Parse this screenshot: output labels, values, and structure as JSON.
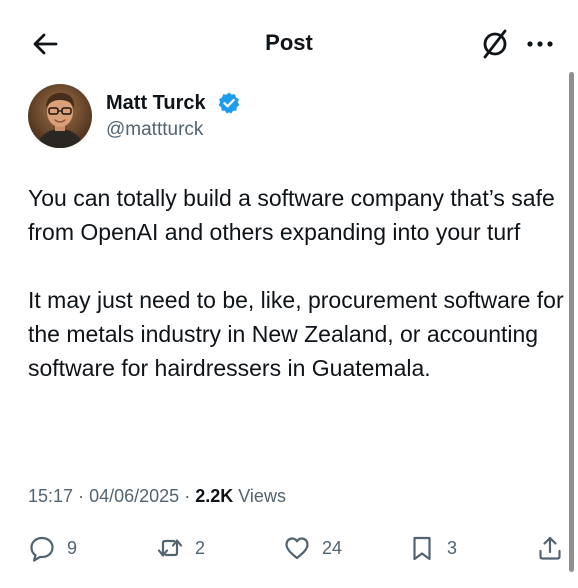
{
  "header": {
    "title": "Post",
    "back_icon": "arrow-left-icon",
    "grok_icon": "grok-icon",
    "more_icon": "more-horizontal-icon"
  },
  "post": {
    "author": {
      "name": "Matt Turck",
      "handle": "@mattturck",
      "verified": true,
      "verified_color": "#1d9bf0"
    },
    "paragraphs": [
      "You can totally build a software company that’s safe from OpenAI and others expanding into your turf",
      "It may just need to be, like, procurement software for the metals industry in New Zealand, or accounting software for hairdressers in Guatemala."
    ],
    "meta": {
      "time": "15:17",
      "date": "04/06/2025",
      "separator": "·",
      "views_count": "2.2K",
      "views_label": "Views"
    }
  },
  "actions": {
    "replies": "9",
    "reposts": "2",
    "likes": "24",
    "bookmarks": "3"
  },
  "colors": {
    "text_primary": "#0f1419",
    "text_secondary": "#536471",
    "accent": "#1d9bf0"
  }
}
